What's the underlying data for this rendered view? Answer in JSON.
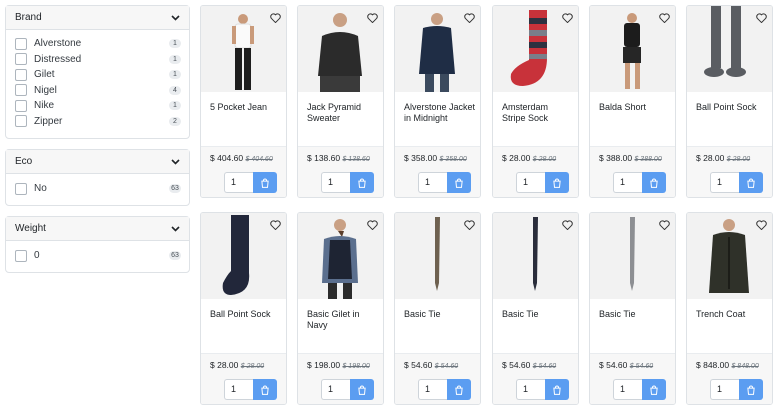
{
  "filters": [
    {
      "title": "Brand",
      "options": [
        {
          "label": "Alverstone",
          "count": "1"
        },
        {
          "label": "Distressed",
          "count": "1"
        },
        {
          "label": "Gilet",
          "count": "1"
        },
        {
          "label": "Nigel",
          "count": "4"
        },
        {
          "label": "Nike",
          "count": "1"
        },
        {
          "label": "Zipper",
          "count": "2"
        }
      ]
    },
    {
      "title": "Eco",
      "options": [
        {
          "label": "No",
          "count": "63"
        }
      ]
    },
    {
      "title": "Weight",
      "options": [
        {
          "label": "0",
          "count": "63"
        }
      ]
    }
  ],
  "products": [
    {
      "name": "5 Pocket Jean",
      "price": "$ 404.60",
      "old_price": "$ 404.60",
      "qty": "1",
      "image": "man-white-tee-black-jeans"
    },
    {
      "name": "Jack Pyramid Sweater",
      "price": "$ 138.60",
      "old_price": "$ 138.60",
      "qty": "1",
      "image": "man-black-sweater"
    },
    {
      "name": "Alverstone Jacket in Midnight",
      "price": "$ 358.00",
      "old_price": "$ 358.00",
      "qty": "1",
      "image": "man-navy-jacket"
    },
    {
      "name": "Amsterdam Stripe Sock",
      "price": "$ 28.00",
      "old_price": "$ 28.00",
      "qty": "1",
      "image": "striped-sock"
    },
    {
      "name": "Balda Short",
      "price": "$ 388.00",
      "old_price": "$ 388.00",
      "qty": "1",
      "image": "man-black-shorts"
    },
    {
      "name": "Ball Point Sock",
      "price": "$ 28.00",
      "old_price": "$ 28.00",
      "qty": "1",
      "image": "grey-socks-legs"
    },
    {
      "name": "Ball Point Sock",
      "price": "$ 28.00",
      "old_price": "$ 28.00",
      "qty": "1",
      "image": "navy-sock"
    },
    {
      "name": "Basic Gilet in Navy",
      "price": "$ 198.00",
      "old_price": "$ 198.00",
      "qty": "1",
      "image": "man-navy-gilet"
    },
    {
      "name": "Basic Tie",
      "price": "$ 54.60",
      "old_price": "$ 54.60",
      "qty": "1",
      "image": "brown-tie"
    },
    {
      "name": "Basic Tie",
      "price": "$ 54.60",
      "old_price": "$ 54.60",
      "qty": "1",
      "image": "navy-tie"
    },
    {
      "name": "Basic Tie",
      "price": "$ 54.60",
      "old_price": "$ 54.60",
      "qty": "1",
      "image": "grey-tie"
    },
    {
      "name": "Trench Coat",
      "price": "$ 848.00",
      "old_price": "$ 848.00",
      "qty": "1",
      "image": "man-trench-coat"
    }
  ],
  "colors": {
    "accent": "#5b9df1",
    "panel_header": "#f7f7f7",
    "border": "#dee2e6"
  }
}
